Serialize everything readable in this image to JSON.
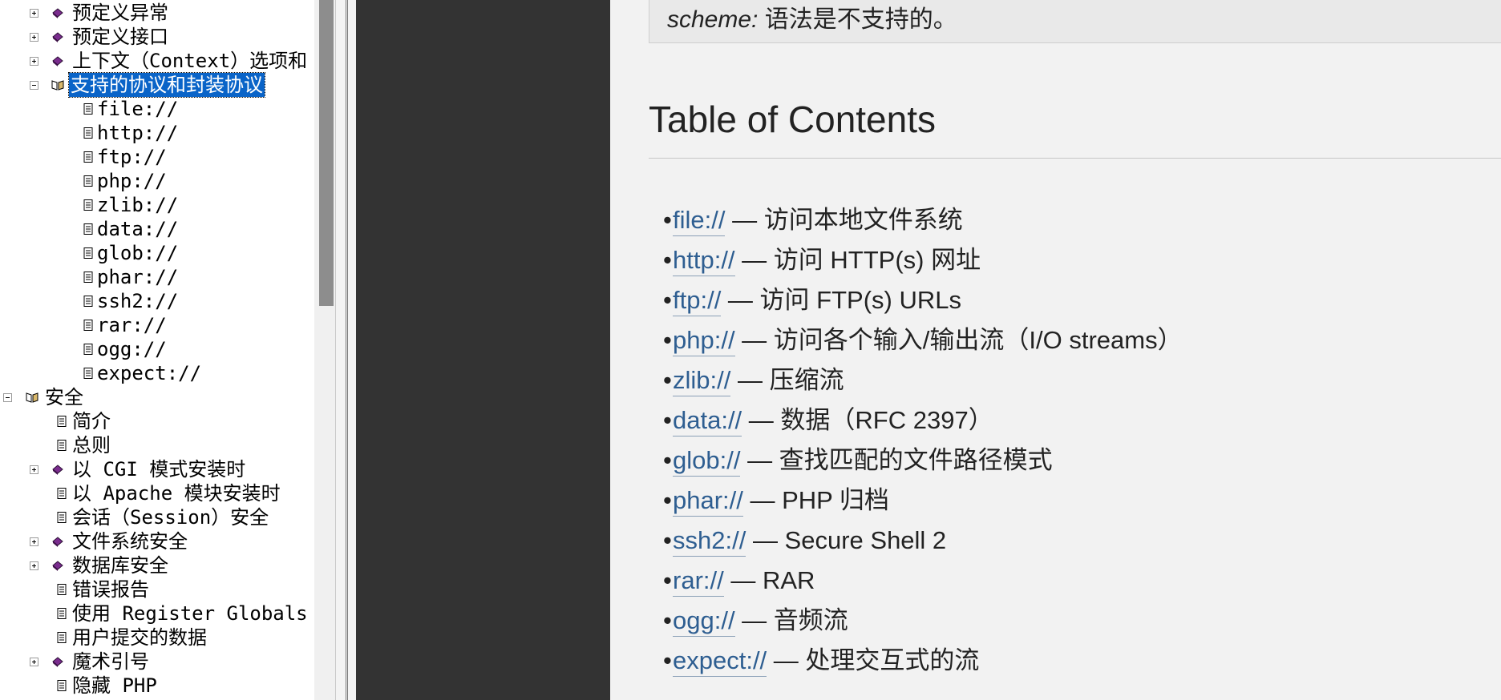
{
  "tree": {
    "rows": [
      {
        "label": "预定义异常",
        "toggle": "plus",
        "icon": "closed-book-icon",
        "selected": false
      },
      {
        "label": "预定义接口",
        "toggle": "plus",
        "icon": "closed-book-icon",
        "selected": false
      },
      {
        "label": "上下文（Context）选项和",
        "toggle": "plus",
        "icon": "closed-book-icon",
        "selected": false
      },
      {
        "label": "支持的协议和封装协议",
        "toggle": "minus",
        "icon": "open-book-icon",
        "selected": true
      },
      {
        "label": "file://",
        "toggle": null,
        "icon": "page-icon",
        "selected": false
      },
      {
        "label": "http://",
        "toggle": null,
        "icon": "page-icon",
        "selected": false
      },
      {
        "label": "ftp://",
        "toggle": null,
        "icon": "page-icon",
        "selected": false
      },
      {
        "label": "php://",
        "toggle": null,
        "icon": "page-icon",
        "selected": false
      },
      {
        "label": "zlib://",
        "toggle": null,
        "icon": "page-icon",
        "selected": false
      },
      {
        "label": "data://",
        "toggle": null,
        "icon": "page-icon",
        "selected": false
      },
      {
        "label": "glob://",
        "toggle": null,
        "icon": "page-icon",
        "selected": false
      },
      {
        "label": "phar://",
        "toggle": null,
        "icon": "page-icon",
        "selected": false
      },
      {
        "label": "ssh2://",
        "toggle": null,
        "icon": "page-icon",
        "selected": false
      },
      {
        "label": "rar://",
        "toggle": null,
        "icon": "page-icon",
        "selected": false
      },
      {
        "label": "ogg://",
        "toggle": null,
        "icon": "page-icon",
        "selected": false
      },
      {
        "label": "expect://",
        "toggle": null,
        "icon": "page-icon",
        "selected": false
      },
      {
        "label": "安全",
        "toggle": "minus",
        "icon": "open-book-icon",
        "selected": false
      },
      {
        "label": "简介",
        "toggle": null,
        "icon": "page-icon",
        "selected": false
      },
      {
        "label": "总则",
        "toggle": null,
        "icon": "page-icon",
        "selected": false
      },
      {
        "label": "以 CGI 模式安装时",
        "toggle": "plus",
        "icon": "closed-book-icon",
        "selected": false
      },
      {
        "label": "以 Apache 模块安装时",
        "toggle": null,
        "icon": "page-icon",
        "selected": false
      },
      {
        "label": "会话（Session）安全",
        "toggle": null,
        "icon": "page-icon",
        "selected": false
      },
      {
        "label": "文件系统安全",
        "toggle": "plus",
        "icon": "closed-book-icon",
        "selected": false
      },
      {
        "label": "数据库安全",
        "toggle": "plus",
        "icon": "closed-book-icon",
        "selected": false
      },
      {
        "label": "错误报告",
        "toggle": null,
        "icon": "page-icon",
        "selected": false
      },
      {
        "label": "使用 Register Globals",
        "toggle": null,
        "icon": "page-icon",
        "selected": false
      },
      {
        "label": "用户提交的数据",
        "toggle": null,
        "icon": "page-icon",
        "selected": false
      },
      {
        "label": "魔术引号",
        "toggle": "plus",
        "icon": "closed-book-icon",
        "selected": false
      },
      {
        "label": "隐藏 PHP",
        "toggle": null,
        "icon": "page-icon",
        "selected": false
      }
    ]
  },
  "content": {
    "note": {
      "scheme": "scheme:",
      "rest": " 语法是不支持的。"
    },
    "toc_title": "Table of Contents",
    "toc_items": [
      {
        "link": "file://",
        "desc": " — 访问本地文件系统"
      },
      {
        "link": "http://",
        "desc": " — 访问 HTTP(s) 网址"
      },
      {
        "link": "ftp://",
        "desc": " — 访问 FTP(s) URLs"
      },
      {
        "link": "php://",
        "desc": " — 访问各个输入/输出流（I/O streams）"
      },
      {
        "link": "zlib://",
        "desc": " — 压缩流"
      },
      {
        "link": "data://",
        "desc": " — 数据（RFC 2397）"
      },
      {
        "link": "glob://",
        "desc": " — 查找匹配的文件路径模式"
      },
      {
        "link": "phar://",
        "desc": " — PHP 归档"
      },
      {
        "link": "ssh2://",
        "desc": " — Secure Shell 2"
      },
      {
        "link": "rar://",
        "desc": " — RAR"
      },
      {
        "link": "ogg://",
        "desc": " — 音频流"
      },
      {
        "link": "expect://",
        "desc": " — 处理交互式的流"
      }
    ]
  },
  "colors": {
    "selection": "#0a64c8",
    "link": "#2e5e91",
    "dark_gutter": "#333333",
    "content_bg": "#f2f2f2"
  }
}
